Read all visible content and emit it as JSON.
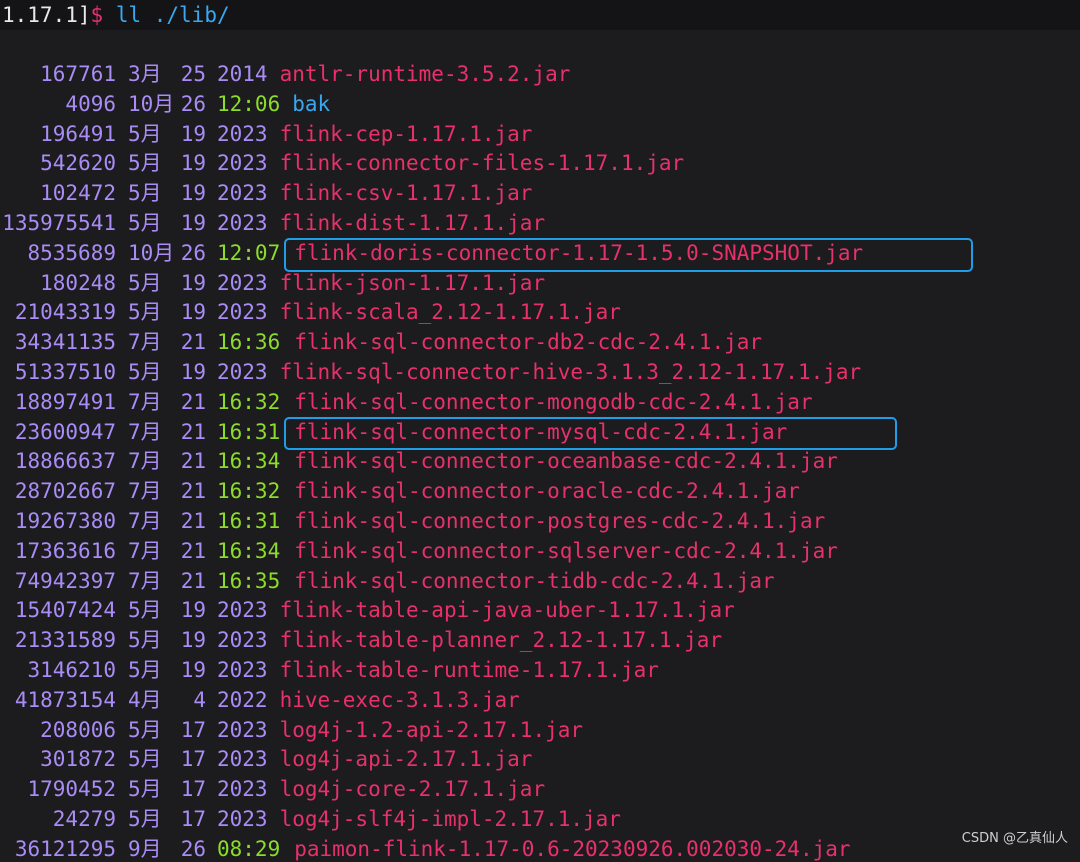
{
  "prompt": {
    "path": "1.17.1]",
    "dollar": "$",
    "command": " ll ./lib/"
  },
  "colors": {
    "background": "#1c1c1e",
    "size": "#a98cf5",
    "time": "#8ddc2a",
    "jar": "#e8306a",
    "directory": "#39a8f0",
    "highlight": "#1e9ee8"
  },
  "files": [
    {
      "size": "167761",
      "month": "3月",
      "day": "25",
      "time_or_year": "2014",
      "is_time": false,
      "name": "antlr-runtime-3.5.2.jar",
      "type": "jar"
    },
    {
      "size": "4096",
      "month": "10月",
      "day": "26",
      "time_or_year": "12:06",
      "is_time": true,
      "name": "bak",
      "type": "dir"
    },
    {
      "size": "196491",
      "month": "5月",
      "day": "19",
      "time_or_year": "2023",
      "is_time": false,
      "name": "flink-cep-1.17.1.jar",
      "type": "jar"
    },
    {
      "size": "542620",
      "month": "5月",
      "day": "19",
      "time_or_year": "2023",
      "is_time": false,
      "name": "flink-connector-files-1.17.1.jar",
      "type": "jar"
    },
    {
      "size": "102472",
      "month": "5月",
      "day": "19",
      "time_or_year": "2023",
      "is_time": false,
      "name": "flink-csv-1.17.1.jar",
      "type": "jar"
    },
    {
      "size": "135975541",
      "month": "5月",
      "day": "19",
      "time_or_year": "2023",
      "is_time": false,
      "name": "flink-dist-1.17.1.jar",
      "type": "jar"
    },
    {
      "size": "8535689",
      "month": "10月",
      "day": "26",
      "time_or_year": "12:07",
      "is_time": true,
      "name": "flink-doris-connector-1.17-1.5.0-SNAPSHOT.jar",
      "type": "jar",
      "highlighted": true
    },
    {
      "size": "180248",
      "month": "5月",
      "day": "19",
      "time_or_year": "2023",
      "is_time": false,
      "name": "flink-json-1.17.1.jar",
      "type": "jar"
    },
    {
      "size": "21043319",
      "month": "5月",
      "day": "19",
      "time_or_year": "2023",
      "is_time": false,
      "name": "flink-scala_2.12-1.17.1.jar",
      "type": "jar"
    },
    {
      "size": "34341135",
      "month": "7月",
      "day": "21",
      "time_or_year": "16:36",
      "is_time": true,
      "name": "flink-sql-connector-db2-cdc-2.4.1.jar",
      "type": "jar"
    },
    {
      "size": "51337510",
      "month": "5月",
      "day": "19",
      "time_or_year": "2023",
      "is_time": false,
      "name": "flink-sql-connector-hive-3.1.3_2.12-1.17.1.jar",
      "type": "jar"
    },
    {
      "size": "18897491",
      "month": "7月",
      "day": "21",
      "time_or_year": "16:32",
      "is_time": true,
      "name": "flink-sql-connector-mongodb-cdc-2.4.1.jar",
      "type": "jar"
    },
    {
      "size": "23600947",
      "month": "7月",
      "day": "21",
      "time_or_year": "16:31",
      "is_time": true,
      "name": "flink-sql-connector-mysql-cdc-2.4.1.jar",
      "type": "jar",
      "highlighted": true
    },
    {
      "size": "18866637",
      "month": "7月",
      "day": "21",
      "time_or_year": "16:34",
      "is_time": true,
      "name": "flink-sql-connector-oceanbase-cdc-2.4.1.jar",
      "type": "jar"
    },
    {
      "size": "28702667",
      "month": "7月",
      "day": "21",
      "time_or_year": "16:32",
      "is_time": true,
      "name": "flink-sql-connector-oracle-cdc-2.4.1.jar",
      "type": "jar"
    },
    {
      "size": "19267380",
      "month": "7月",
      "day": "21",
      "time_or_year": "16:31",
      "is_time": true,
      "name": "flink-sql-connector-postgres-cdc-2.4.1.jar",
      "type": "jar"
    },
    {
      "size": "17363616",
      "month": "7月",
      "day": "21",
      "time_or_year": "16:34",
      "is_time": true,
      "name": "flink-sql-connector-sqlserver-cdc-2.4.1.jar",
      "type": "jar"
    },
    {
      "size": "74942397",
      "month": "7月",
      "day": "21",
      "time_or_year": "16:35",
      "is_time": true,
      "name": "flink-sql-connector-tidb-cdc-2.4.1.jar",
      "type": "jar"
    },
    {
      "size": "15407424",
      "month": "5月",
      "day": "19",
      "time_or_year": "2023",
      "is_time": false,
      "name": "flink-table-api-java-uber-1.17.1.jar",
      "type": "jar"
    },
    {
      "size": "21331589",
      "month": "5月",
      "day": "19",
      "time_or_year": "2023",
      "is_time": false,
      "name": "flink-table-planner_2.12-1.17.1.jar",
      "type": "jar"
    },
    {
      "size": "3146210",
      "month": "5月",
      "day": "19",
      "time_or_year": "2023",
      "is_time": false,
      "name": "flink-table-runtime-1.17.1.jar",
      "type": "jar"
    },
    {
      "size": "41873154",
      "month": "4月",
      "day": "4",
      "time_or_year": "2022",
      "is_time": false,
      "name": "hive-exec-3.1.3.jar",
      "type": "jar"
    },
    {
      "size": "208006",
      "month": "5月",
      "day": "17",
      "time_or_year": "2023",
      "is_time": false,
      "name": "log4j-1.2-api-2.17.1.jar",
      "type": "jar"
    },
    {
      "size": "301872",
      "month": "5月",
      "day": "17",
      "time_or_year": "2023",
      "is_time": false,
      "name": "log4j-api-2.17.1.jar",
      "type": "jar"
    },
    {
      "size": "1790452",
      "month": "5月",
      "day": "17",
      "time_or_year": "2023",
      "is_time": false,
      "name": "log4j-core-2.17.1.jar",
      "type": "jar"
    },
    {
      "size": "24279",
      "month": "5月",
      "day": "17",
      "time_or_year": "2023",
      "is_time": false,
      "name": "log4j-slf4j-impl-2.17.1.jar",
      "type": "jar"
    },
    {
      "size": "36121295",
      "month": "9月",
      "day": "26",
      "time_or_year": "08:29",
      "is_time": true,
      "name": "paimon-flink-1.17-0.6-20230926.002030-24.jar",
      "type": "jar"
    }
  ],
  "watermark": "CSDN @乙真仙人"
}
